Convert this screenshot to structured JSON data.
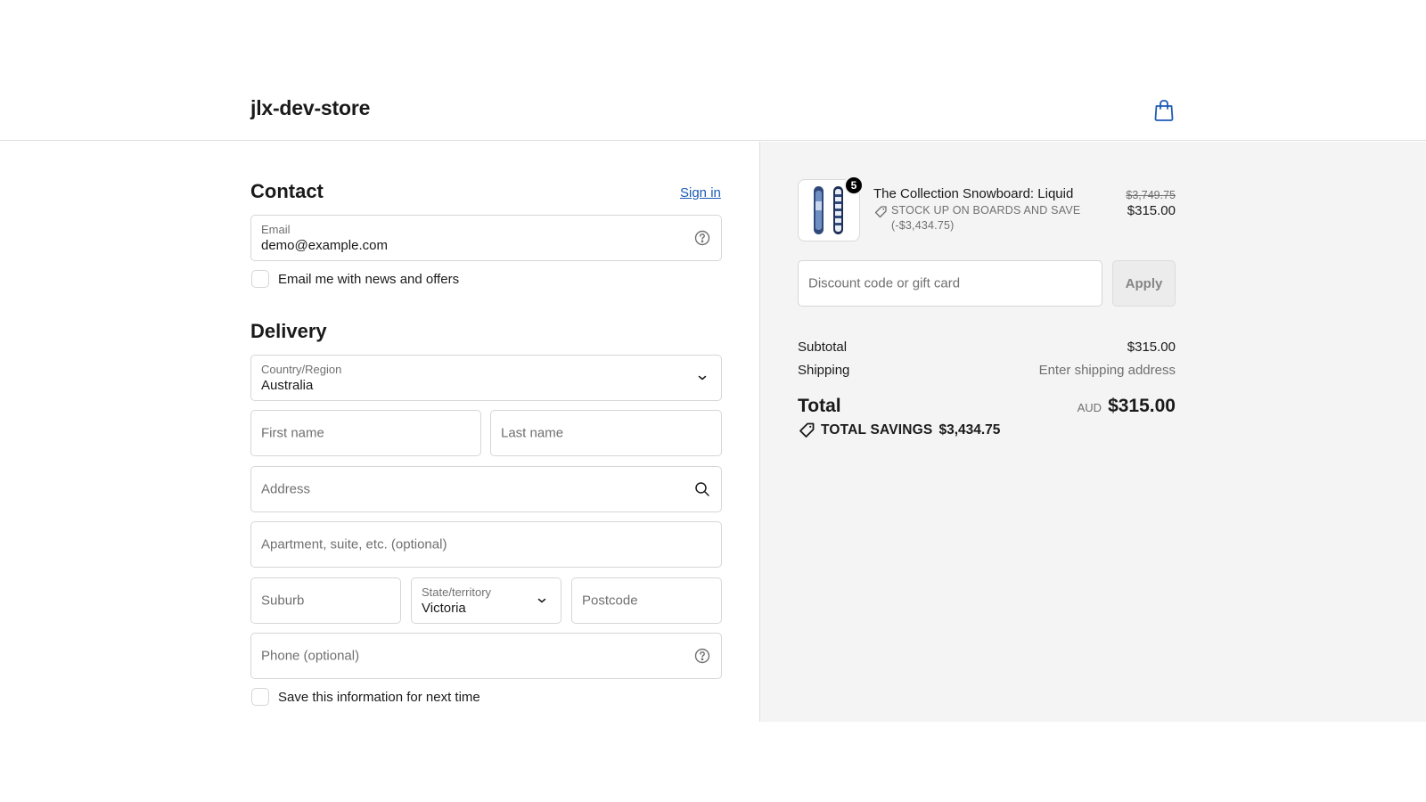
{
  "header": {
    "store_name": "jlx-dev-store",
    "cart_icon": "shopping-bag-icon"
  },
  "contact": {
    "title": "Contact",
    "sign_in": "Sign in",
    "email_label": "Email",
    "email_value": "demo@example.com",
    "email_help_icon": "question-circle-icon",
    "newsletter_label": "Email me with news and offers"
  },
  "delivery": {
    "title": "Delivery",
    "country_label": "Country/Region",
    "country_value": "Australia",
    "first_name_placeholder": "First name",
    "last_name_placeholder": "Last name",
    "address_placeholder": "Address",
    "apartment_placeholder": "Apartment, suite, etc. (optional)",
    "suburb_placeholder": "Suburb",
    "state_label": "State/territory",
    "state_value": "Victoria",
    "postcode_placeholder": "Postcode",
    "phone_placeholder": "Phone (optional)",
    "save_info_label": "Save this information for next time"
  },
  "order_summary": {
    "product": {
      "title": "The Collection Snowboard: Liquid",
      "quantity": "5",
      "discount_text": "STOCK UP ON BOARDS AND SAVE (-$3,434.75)",
      "original_price": "$3,749.75",
      "price": "$315.00"
    },
    "discount_placeholder": "Discount code or gift card",
    "apply_label": "Apply",
    "subtotal_label": "Subtotal",
    "subtotal_value": "$315.00",
    "shipping_label": "Shipping",
    "shipping_value": "Enter shipping address",
    "total_label": "Total",
    "total_currency": "AUD",
    "total_value": "$315.00",
    "savings_label": "TOTAL SAVINGS",
    "savings_value": "$3,434.75"
  },
  "colors": {
    "link": "#1d5bb5",
    "sidebar_bg": "#f4f4f4",
    "border": "#d6d6d6",
    "muted_text": "#707070"
  }
}
